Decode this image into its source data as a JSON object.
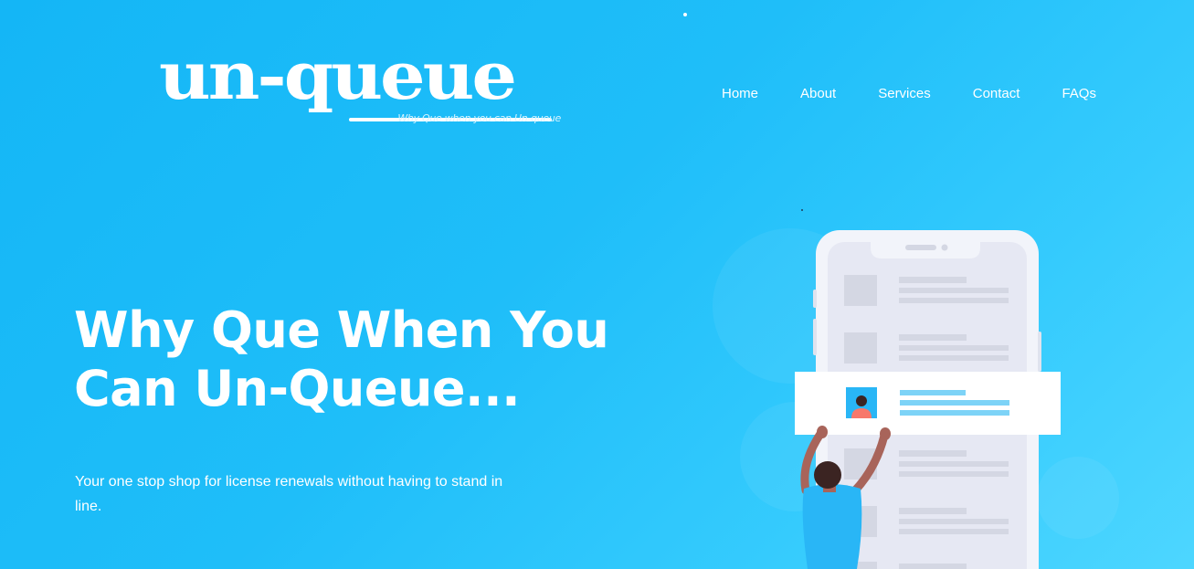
{
  "brand": {
    "logo_text": "un-queue",
    "tagline": "Why Que when you can Un-queue"
  },
  "nav": {
    "items": [
      {
        "label": "Home"
      },
      {
        "label": "About"
      },
      {
        "label": "Services"
      },
      {
        "label": "Contact"
      },
      {
        "label": "FAQs"
      }
    ]
  },
  "hero": {
    "title_line1": "Why Que When You",
    "title_line2": "Can Un-Queue...",
    "subtitle": "Your one stop shop for license renewals without having to stand in line."
  },
  "illustration": {
    "icon": "phone-app-person-illustration",
    "colors": {
      "phone_body": "#f2f4fa",
      "screen": "#e6e8f3",
      "accent": "#7dd3f7",
      "skin": "#a8645a",
      "shirt": "#29b6f6",
      "card": "#ffffff",
      "placeholder": "#d4d7e3"
    }
  },
  "theme": {
    "bg_start": "#14b6f6",
    "bg_end": "#4dd6ff",
    "text": "#ffffff"
  }
}
